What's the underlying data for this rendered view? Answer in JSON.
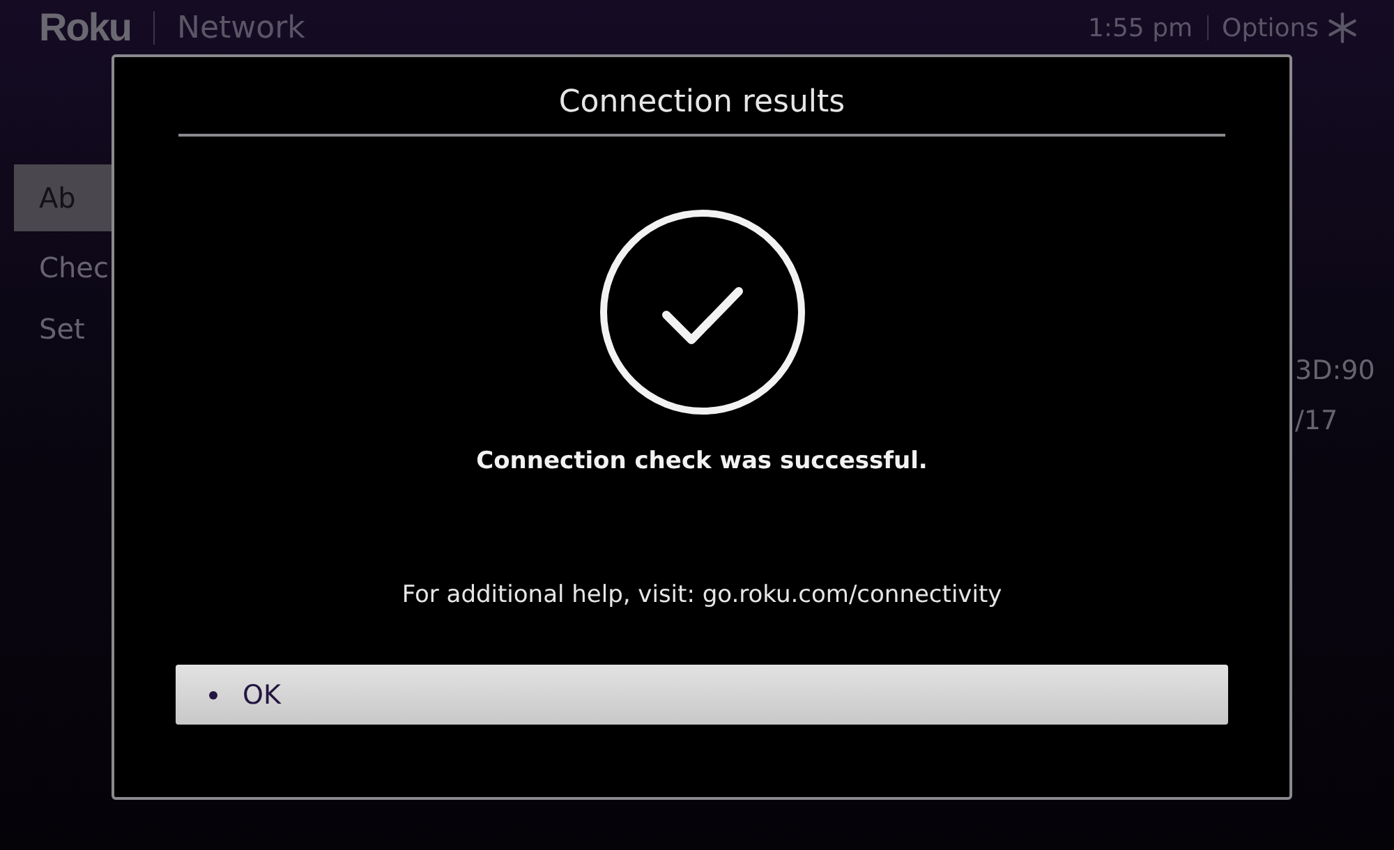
{
  "header": {
    "logo": "Roku",
    "title": "Network",
    "time": "1:55 pm",
    "options": "Options"
  },
  "menu": [
    {
      "label": "Ab",
      "selected": true
    },
    {
      "label": "Chec",
      "selected": false
    },
    {
      "label": "Set",
      "selected": false
    }
  ],
  "info_values": [
    "3D:90",
    "/17"
  ],
  "dialog": {
    "title": "Connection results",
    "message": "Connection check was successful.",
    "help": "For additional help, visit: go.roku.com/connectivity",
    "buttons": [
      {
        "label": "OK",
        "selected": true
      }
    ]
  }
}
